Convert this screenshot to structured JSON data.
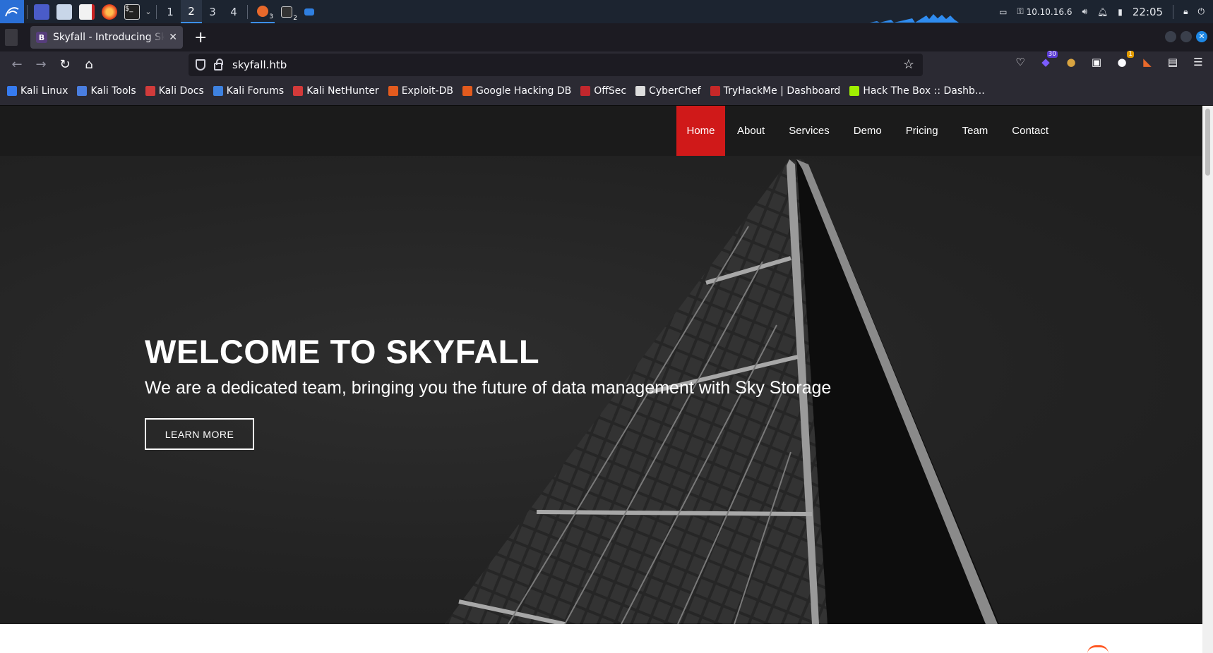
{
  "taskbar": {
    "workspaces": [
      "1",
      "2",
      "3",
      "4"
    ],
    "active_workspace": "2",
    "app_badges": [
      "3",
      "2"
    ],
    "ip": "10.10.16.6",
    "clock": "22:05"
  },
  "browser": {
    "tab_title": "Skyfall - Introducing Sky Storage!",
    "tab_favicon": "B",
    "url": "skyfall.htb",
    "extension_badges": [
      "30",
      "1"
    ],
    "bookmarks": [
      {
        "label": "Kali Linux",
        "icon": "kali-icon",
        "color": "#367bf0"
      },
      {
        "label": "Kali Tools",
        "icon": "kali-tools-icon",
        "color": "#4a7ee0"
      },
      {
        "label": "Kali Docs",
        "icon": "kali-docs-icon",
        "color": "#d13b3b"
      },
      {
        "label": "Kali Forums",
        "icon": "kali-forums-icon",
        "color": "#3e82e0"
      },
      {
        "label": "Kali NetHunter",
        "icon": "nethunter-icon",
        "color": "#d33a3a"
      },
      {
        "label": "Exploit-DB",
        "icon": "exploit-db-icon",
        "color": "#e35b1e"
      },
      {
        "label": "Google Hacking DB",
        "icon": "ghdb-icon",
        "color": "#e35b1e"
      },
      {
        "label": "OffSec",
        "icon": "offsec-icon",
        "color": "#c2272d"
      },
      {
        "label": "CyberChef",
        "icon": "cyberchef-icon",
        "color": "#dddddd"
      },
      {
        "label": "TryHackMe | Dashboard",
        "icon": "tryhackme-icon",
        "color": "#c62828"
      },
      {
        "label": "Hack The Box :: Dashb…",
        "icon": "hackthebox-icon",
        "color": "#9fef00"
      }
    ]
  },
  "site": {
    "menu": [
      "Home",
      "About",
      "Services",
      "Demo",
      "Pricing",
      "Team",
      "Contact"
    ],
    "active_menu": "Home",
    "hero_title": "WELCOME TO SKYFALL",
    "hero_subtitle": "We are a dedicated team, bringing you the future of data management with Sky Storage",
    "hero_button": "LEARN MORE",
    "accent_color": "#d01919"
  }
}
